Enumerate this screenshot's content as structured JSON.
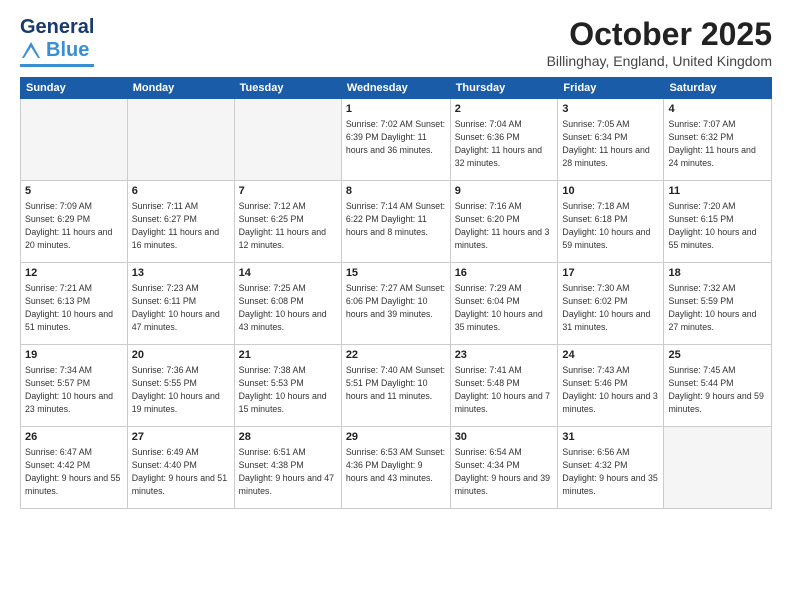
{
  "header": {
    "logo_general": "General",
    "logo_blue": "Blue",
    "month_title": "October 2025",
    "location": "Billinghay, England, United Kingdom"
  },
  "days_of_week": [
    "Sunday",
    "Monday",
    "Tuesday",
    "Wednesday",
    "Thursday",
    "Friday",
    "Saturday"
  ],
  "weeks": [
    [
      {
        "day": "",
        "info": ""
      },
      {
        "day": "",
        "info": ""
      },
      {
        "day": "",
        "info": ""
      },
      {
        "day": "1",
        "info": "Sunrise: 7:02 AM\nSunset: 6:39 PM\nDaylight: 11 hours\nand 36 minutes."
      },
      {
        "day": "2",
        "info": "Sunrise: 7:04 AM\nSunset: 6:36 PM\nDaylight: 11 hours\nand 32 minutes."
      },
      {
        "day": "3",
        "info": "Sunrise: 7:05 AM\nSunset: 6:34 PM\nDaylight: 11 hours\nand 28 minutes."
      },
      {
        "day": "4",
        "info": "Sunrise: 7:07 AM\nSunset: 6:32 PM\nDaylight: 11 hours\nand 24 minutes."
      }
    ],
    [
      {
        "day": "5",
        "info": "Sunrise: 7:09 AM\nSunset: 6:29 PM\nDaylight: 11 hours\nand 20 minutes."
      },
      {
        "day": "6",
        "info": "Sunrise: 7:11 AM\nSunset: 6:27 PM\nDaylight: 11 hours\nand 16 minutes."
      },
      {
        "day": "7",
        "info": "Sunrise: 7:12 AM\nSunset: 6:25 PM\nDaylight: 11 hours\nand 12 minutes."
      },
      {
        "day": "8",
        "info": "Sunrise: 7:14 AM\nSunset: 6:22 PM\nDaylight: 11 hours\nand 8 minutes."
      },
      {
        "day": "9",
        "info": "Sunrise: 7:16 AM\nSunset: 6:20 PM\nDaylight: 11 hours\nand 3 minutes."
      },
      {
        "day": "10",
        "info": "Sunrise: 7:18 AM\nSunset: 6:18 PM\nDaylight: 10 hours\nand 59 minutes."
      },
      {
        "day": "11",
        "info": "Sunrise: 7:20 AM\nSunset: 6:15 PM\nDaylight: 10 hours\nand 55 minutes."
      }
    ],
    [
      {
        "day": "12",
        "info": "Sunrise: 7:21 AM\nSunset: 6:13 PM\nDaylight: 10 hours\nand 51 minutes."
      },
      {
        "day": "13",
        "info": "Sunrise: 7:23 AM\nSunset: 6:11 PM\nDaylight: 10 hours\nand 47 minutes."
      },
      {
        "day": "14",
        "info": "Sunrise: 7:25 AM\nSunset: 6:08 PM\nDaylight: 10 hours\nand 43 minutes."
      },
      {
        "day": "15",
        "info": "Sunrise: 7:27 AM\nSunset: 6:06 PM\nDaylight: 10 hours\nand 39 minutes."
      },
      {
        "day": "16",
        "info": "Sunrise: 7:29 AM\nSunset: 6:04 PM\nDaylight: 10 hours\nand 35 minutes."
      },
      {
        "day": "17",
        "info": "Sunrise: 7:30 AM\nSunset: 6:02 PM\nDaylight: 10 hours\nand 31 minutes."
      },
      {
        "day": "18",
        "info": "Sunrise: 7:32 AM\nSunset: 5:59 PM\nDaylight: 10 hours\nand 27 minutes."
      }
    ],
    [
      {
        "day": "19",
        "info": "Sunrise: 7:34 AM\nSunset: 5:57 PM\nDaylight: 10 hours\nand 23 minutes."
      },
      {
        "day": "20",
        "info": "Sunrise: 7:36 AM\nSunset: 5:55 PM\nDaylight: 10 hours\nand 19 minutes."
      },
      {
        "day": "21",
        "info": "Sunrise: 7:38 AM\nSunset: 5:53 PM\nDaylight: 10 hours\nand 15 minutes."
      },
      {
        "day": "22",
        "info": "Sunrise: 7:40 AM\nSunset: 5:51 PM\nDaylight: 10 hours\nand 11 minutes."
      },
      {
        "day": "23",
        "info": "Sunrise: 7:41 AM\nSunset: 5:48 PM\nDaylight: 10 hours\nand 7 minutes."
      },
      {
        "day": "24",
        "info": "Sunrise: 7:43 AM\nSunset: 5:46 PM\nDaylight: 10 hours\nand 3 minutes."
      },
      {
        "day": "25",
        "info": "Sunrise: 7:45 AM\nSunset: 5:44 PM\nDaylight: 9 hours\nand 59 minutes."
      }
    ],
    [
      {
        "day": "26",
        "info": "Sunrise: 6:47 AM\nSunset: 4:42 PM\nDaylight: 9 hours\nand 55 minutes."
      },
      {
        "day": "27",
        "info": "Sunrise: 6:49 AM\nSunset: 4:40 PM\nDaylight: 9 hours\nand 51 minutes."
      },
      {
        "day": "28",
        "info": "Sunrise: 6:51 AM\nSunset: 4:38 PM\nDaylight: 9 hours\nand 47 minutes."
      },
      {
        "day": "29",
        "info": "Sunrise: 6:53 AM\nSunset: 4:36 PM\nDaylight: 9 hours\nand 43 minutes."
      },
      {
        "day": "30",
        "info": "Sunrise: 6:54 AM\nSunset: 4:34 PM\nDaylight: 9 hours\nand 39 minutes."
      },
      {
        "day": "31",
        "info": "Sunrise: 6:56 AM\nSunset: 4:32 PM\nDaylight: 9 hours\nand 35 minutes."
      },
      {
        "day": "",
        "info": ""
      }
    ]
  ]
}
